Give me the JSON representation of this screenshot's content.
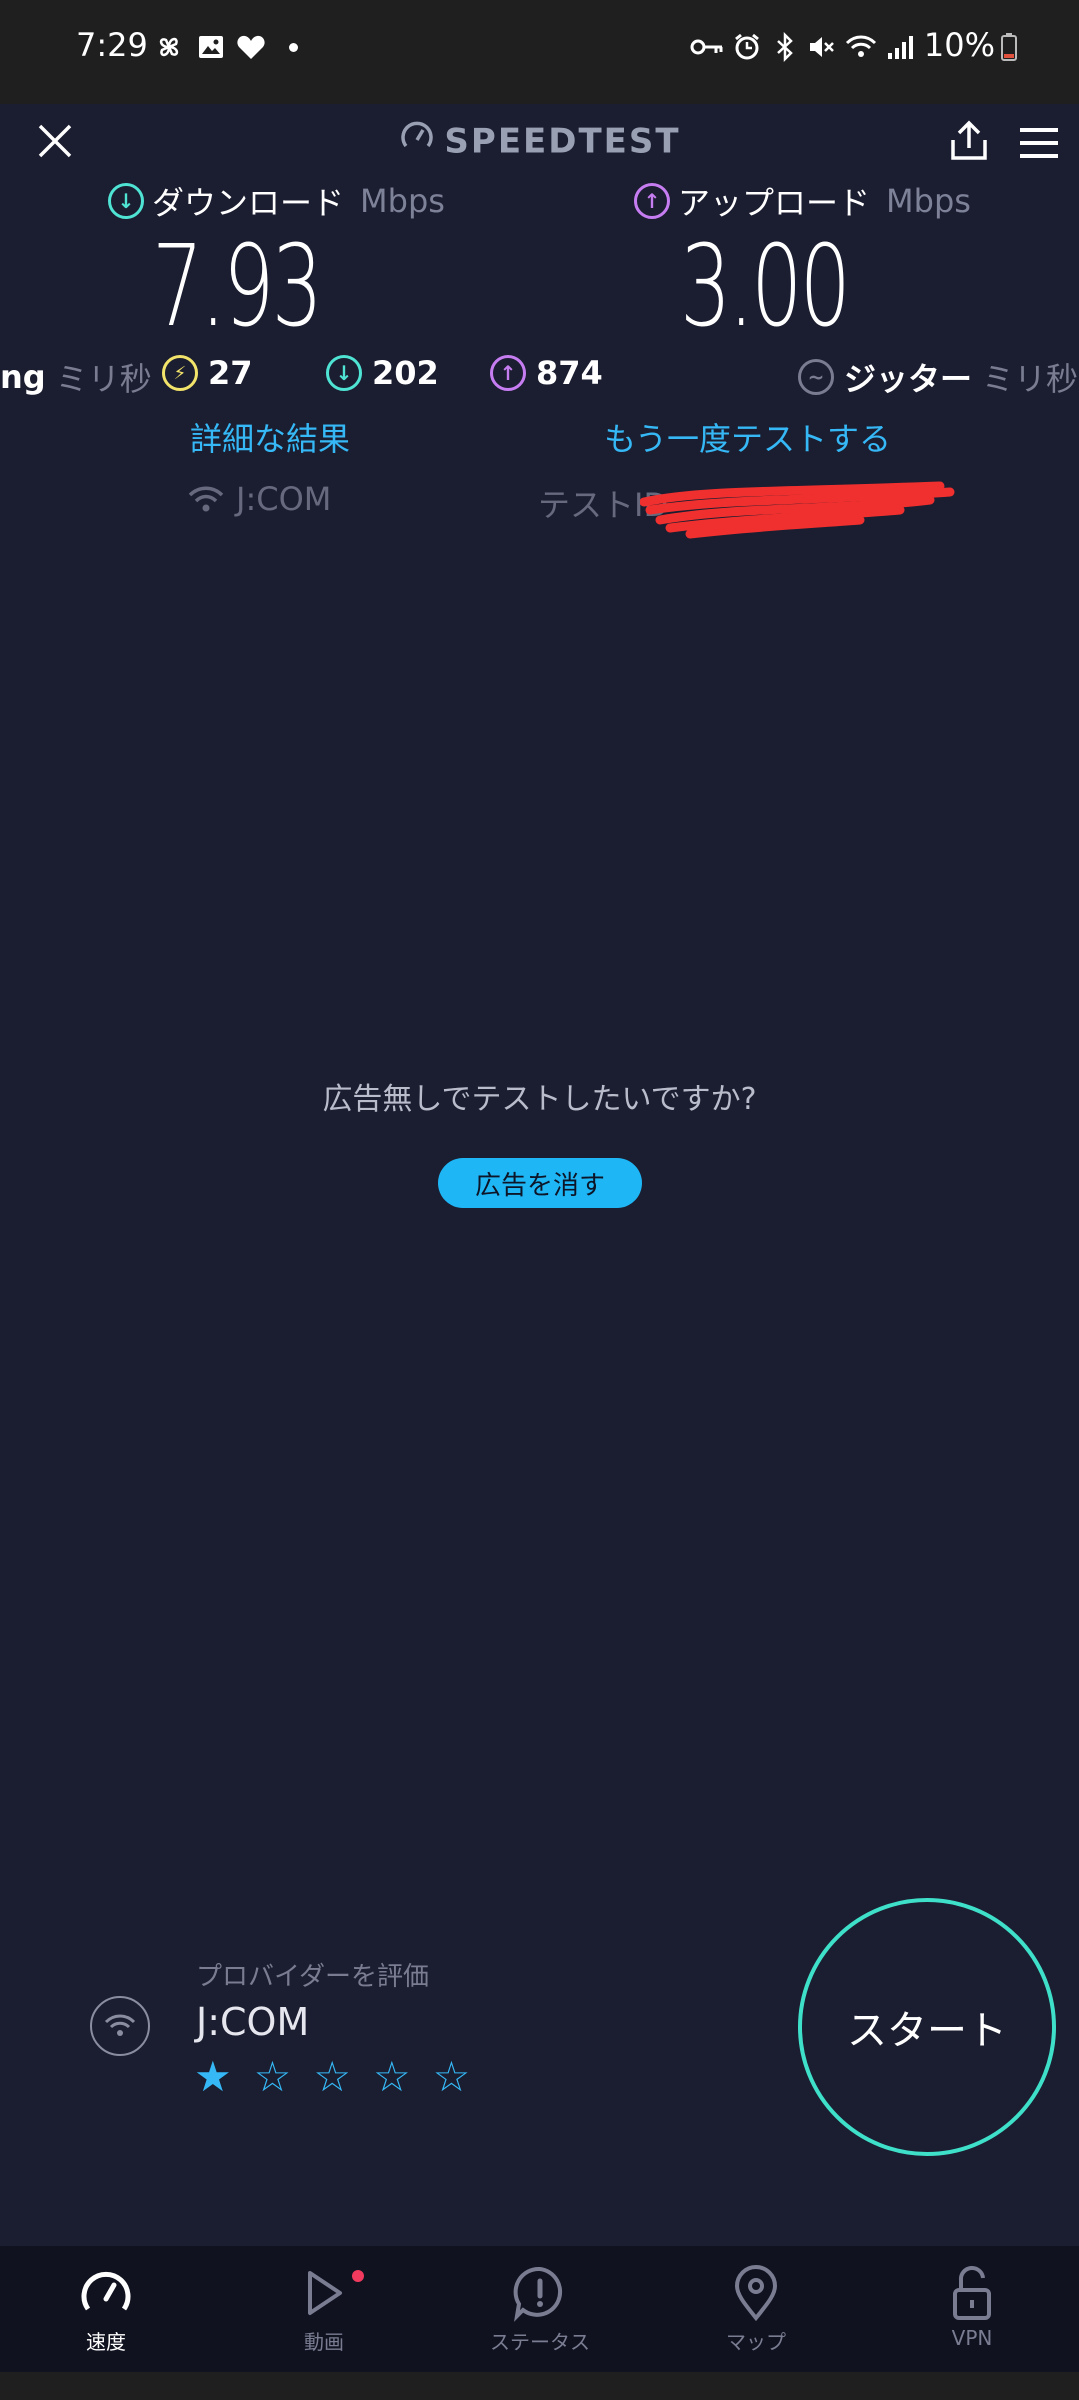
{
  "status_bar": {
    "time": "7:29",
    "battery": "10%"
  },
  "header": {
    "title": "SPEEDTEST"
  },
  "download": {
    "label": "ダウンロード",
    "unit": "Mbps",
    "value": "7.93"
  },
  "upload": {
    "label": "アップロード",
    "unit": "Mbps",
    "value": "3.00"
  },
  "latency": {
    "ping_label": "ng",
    "ping_unit": "ミリ秒",
    "idle": "27",
    "download": "202",
    "upload": "874",
    "jitter_label": "ジッター",
    "jitter_unit": "ミリ秒"
  },
  "links": {
    "details": "詳細な結果",
    "retest": "もう一度テストする"
  },
  "connection": {
    "provider": "J:COM",
    "test_id_label": "テストID"
  },
  "ad": {
    "question": "広告無しでテストしたいですか?",
    "remove_button": "広告を消す"
  },
  "provider_rating": {
    "label": "プロバイダーを評価",
    "name": "J:COM",
    "rating": 1,
    "max": 5
  },
  "start_button": "スタート",
  "nav": {
    "items": [
      {
        "label": "速度",
        "icon": "speedometer-icon",
        "active": true
      },
      {
        "label": "動画",
        "icon": "play-icon",
        "active": false
      },
      {
        "label": "ステータス",
        "icon": "alert-icon",
        "active": false
      },
      {
        "label": "マップ",
        "icon": "map-pin-icon",
        "active": false
      },
      {
        "label": "VPN",
        "icon": "lock-icon",
        "active": false
      }
    ]
  },
  "colors": {
    "background": "#1b1d30",
    "accent_blue": "#35b8f5",
    "start_ring": "#3ee0c9",
    "download": "#4fe3d4",
    "upload": "#c77df2",
    "idle": "#f2e36b"
  }
}
